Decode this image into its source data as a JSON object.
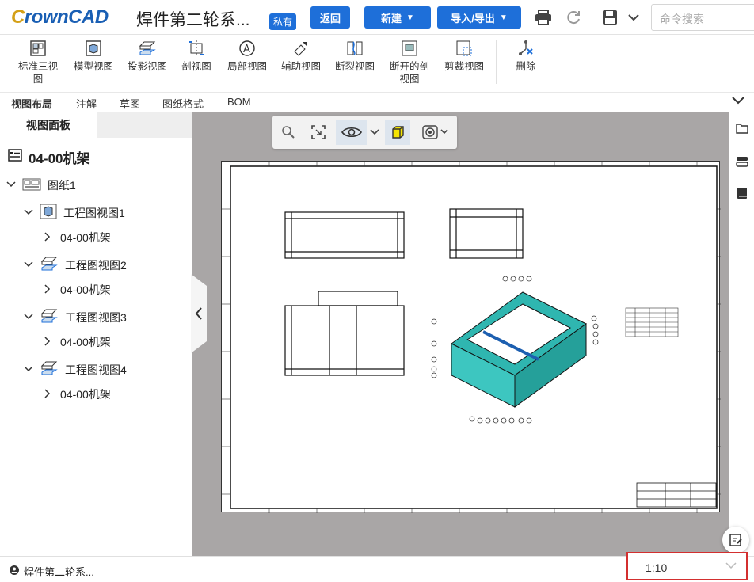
{
  "app": {
    "logo_c": "C",
    "logo_rest": "rownCAD",
    "doc_title": "焊件第二轮系...",
    "badge": "私有"
  },
  "header": {
    "back_label": "返回",
    "new_label": "新建",
    "import_export_label": "导入/导出",
    "search_placeholder": "命令搜索"
  },
  "ribbon": {
    "items": [
      {
        "label": "标准三视图",
        "icon": "standard-three-view-icon"
      },
      {
        "label": "模型视图",
        "icon": "model-view-icon"
      },
      {
        "label": "投影视图",
        "icon": "projected-view-icon"
      },
      {
        "label": "剖视图",
        "icon": "section-view-icon"
      },
      {
        "label": "局部视图",
        "icon": "detail-view-icon"
      },
      {
        "label": "辅助视图",
        "icon": "auxiliary-view-icon"
      },
      {
        "label": "断裂视图",
        "icon": "broken-view-icon"
      },
      {
        "label": "断开的剖视图",
        "icon": "broken-out-section-icon"
      },
      {
        "label": "剪裁视图",
        "icon": "crop-view-icon"
      },
      {
        "label": "删除",
        "icon": "delete-icon"
      }
    ]
  },
  "tabs": [
    {
      "label": "视图布局",
      "active": true
    },
    {
      "label": "注解",
      "active": false
    },
    {
      "label": "草图",
      "active": false
    },
    {
      "label": "图纸格式",
      "active": false
    },
    {
      "label": "BOM",
      "active": false
    }
  ],
  "panel": {
    "tab_label": "视图面板",
    "root": "04-00机架",
    "sheet": "图纸1",
    "views": [
      {
        "label": "工程图视图1",
        "child": "04-00机架"
      },
      {
        "label": "工程图视图2",
        "child": "04-00机架"
      },
      {
        "label": "工程图视图3",
        "child": "04-00机架"
      },
      {
        "label": "工程图视图4",
        "child": "04-00机架"
      }
    ]
  },
  "status": {
    "user_doc": "焊件第二轮系...",
    "scale": "1:10"
  },
  "colors": {
    "accent": "#1e6fd9",
    "highlight_border": "#d32f2f",
    "canvas_bg": "#a9a6a6"
  }
}
